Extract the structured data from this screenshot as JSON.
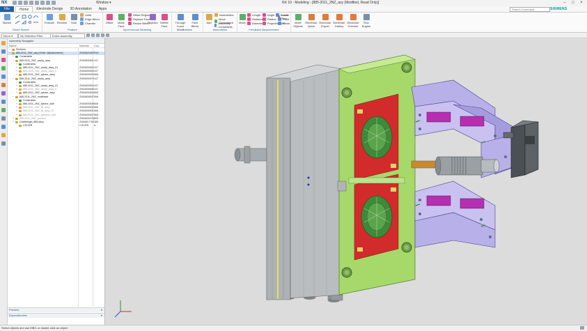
{
  "titlebar": {
    "logo": "NX",
    "window_menu": "Window ▾",
    "title": "NX 10 - Modeling - [885-2011_2NZ_asy (Modified, Read Only)]",
    "brand": "SIEMENS"
  },
  "menubar": {
    "file": "File",
    "tabs": [
      "Home",
      "Electrode Design",
      "3D Annotation",
      "Apps"
    ],
    "active_tab": "Home",
    "search_placeholder": "Search Command"
  },
  "ribbon": {
    "groups": [
      {
        "label": "Direct Sketch",
        "buttons": [
          "Sketch"
        ]
      },
      {
        "label": "Feature",
        "buttons": [
          "Extrude",
          "Revolve",
          "Hole"
        ],
        "rows": [
          "Unite",
          "Edge Blend",
          "Chamfer"
        ]
      },
      {
        "label": "Synchronous Modeling",
        "buttons": [
          "Offset",
          "Move Face",
          "Replace",
          "Delete Face"
        ],
        "rows": [
          "Offset Region",
          "Replace Face",
          "Resize Blend"
        ]
      },
      {
        "label": "Surface",
        "buttons": [
          "Through Curve Mesh",
          "Face Blend"
        ]
      },
      {
        "label": "Assemblies",
        "buttons": [
          "Add",
          "Assembly Constraints"
        ],
        "rows": [
          "Assemblies",
          "Move Component"
        ]
      },
      {
        "label": "Feedback Measurement",
        "buttons": [
          "Move"
        ],
        "rows": [
          "Length",
          "Distance",
          "Diameter",
          "Angle",
          "Radius",
          "Projected Dist",
          "Local Rad",
          "Point",
          "Plane",
          "Border"
        ]
      },
      {
        "label": "",
        "buttons": [
          "Move Objects",
          "Electrode Quick",
          "Electrode Export",
          "Electrode Gallery",
          "Electrode Checker",
          "Rob Engine"
        ]
      }
    ]
  },
  "selbar": {
    "menu": "Menu ▾",
    "filter": "No Selection Filter",
    "scope": "Entire Assembly"
  },
  "navigator": {
    "title": "Assembly Navigator",
    "columns": {
      "name": "Name",
      "number": "Number",
      "count": "Cou"
    },
    "rows": [
      {
        "indent": 0,
        "exp": "−",
        "name": "Sections",
        "number": "",
        "count": "",
        "icon": "#c8a040"
      },
      {
        "indent": 0,
        "exp": "−",
        "name": "885-2011_2NZ_asy (Order: Alphanumeric)",
        "number": "ZN00820483",
        "count": "R42",
        "icon": "#d2a030",
        "selected": true
      },
      {
        "indent": 1,
        "exp": "−",
        "name": "Constraints",
        "number": "",
        "count": "",
        "icon": "#4a8a4a"
      },
      {
        "indent": 1,
        "exp": "−",
        "name": "885-2011_2NZ_cavity_assy",
        "number": "ZN00830501",
        "count": "107",
        "icon": "#d2a030"
      },
      {
        "indent": 2,
        "exp": "+",
        "name": "Constraints",
        "number": "",
        "count": "",
        "icon": "#4a8a4a"
      },
      {
        "indent": 2,
        "exp": "+",
        "name": "885-2011_2NZ_cavity_assy_01",
        "number": "ZN00830503",
        "count": "107",
        "icon": "#d2a030"
      },
      {
        "indent": 2,
        "exp": "+",
        "name": "885-2011_2NZ_cavity_assy_fl",
        "number": "ZN00830505",
        "count": "107",
        "icon": "#d2a030",
        "dim": true
      },
      {
        "indent": 2,
        "exp": "+",
        "name": "885-2011_2NZ_ejector_assy",
        "number": "ZN00830500",
        "count": "808",
        "icon": "#d2a030"
      },
      {
        "indent": 1,
        "exp": "−",
        "name": "885-2011_2NZ_cavity_assy",
        "number": "ZN00830579",
        "count": "107",
        "icon": "#d2a030"
      },
      {
        "indent": 2,
        "exp": "+",
        "name": "Constraints",
        "number": "",
        "count": "",
        "icon": "#4a8a4a"
      },
      {
        "indent": 2,
        "exp": "+",
        "name": "885-2011_2NZ_cavity_assy_01",
        "number": "ZN00830504",
        "count": "107",
        "icon": "#d2a030"
      },
      {
        "indent": 2,
        "exp": "+",
        "name": "885-2011_2NZ_cavity_assy_fl",
        "number": "ZN00830506",
        "count": "107",
        "icon": "#d2a030",
        "dim": true
      },
      {
        "indent": 2,
        "exp": "+",
        "name": "885-2011_2NZ_ejector_assy",
        "number": "ZN00830500",
        "count": "808",
        "icon": "#d2a030"
      },
      {
        "indent": 1,
        "exp": "−",
        "name": "885-2011_2NZ_moldbase",
        "number": "ZN00830507",
        "count": "808",
        "icon": "#d2a030"
      },
      {
        "indent": 2,
        "exp": "+",
        "name": "Constraints",
        "number": "",
        "count": "",
        "icon": "#4a8a4a"
      },
      {
        "indent": 2,
        "exp": "+",
        "name": "885-2011_2NZ_ejector_side",
        "number": "ZN00830505",
        "count": "808",
        "icon": "#d2a030"
      },
      {
        "indent": 2,
        "exp": "+",
        "name": "885-2011_2NZ_fill_assy",
        "number": "ZN00830502",
        "count": "808",
        "icon": "#d2a030",
        "dim": true
      },
      {
        "indent": 2,
        "exp": "+",
        "name": "885-2011_2NZ_fill_assy_02",
        "number": "ZN00830501",
        "count": "808",
        "icon": "#d2a030",
        "dim": true
      },
      {
        "indent": 2,
        "exp": "+",
        "name": "885-2011_2NZ_injection_side",
        "number": "ZN00830507",
        "count": "808",
        "icon": "#d2a030",
        "dim": true
      },
      {
        "indent": 1,
        "exp": "+",
        "name": "885-2011_2NZ_product",
        "number": "ZN00830478",
        "count": "808",
        "icon": "#d2a030",
        "dim": true
      },
      {
        "indent": 1,
        "exp": "−",
        "name": "Grafiteingel_885.assy",
        "number": "ZN00817763",
        "count": "385",
        "icon": "#d2a030"
      },
      {
        "indent": 2,
        "exp": "",
        "name": "CGCRR",
        "number": "CGCRR",
        "count": "A",
        "icon": "#d2a030"
      }
    ],
    "preview_label": "Preview",
    "dependencies_label": "Dependencies"
  },
  "status": {
    "text": "Select objects and use MB3, or double-click an object"
  },
  "colors": {
    "accent": "#1f5fa0",
    "plate_green": "#a6d96a",
    "core_red": "#d22b2b",
    "slider_purple": "#b8b0e8",
    "steel_gray": "#a8acae"
  }
}
